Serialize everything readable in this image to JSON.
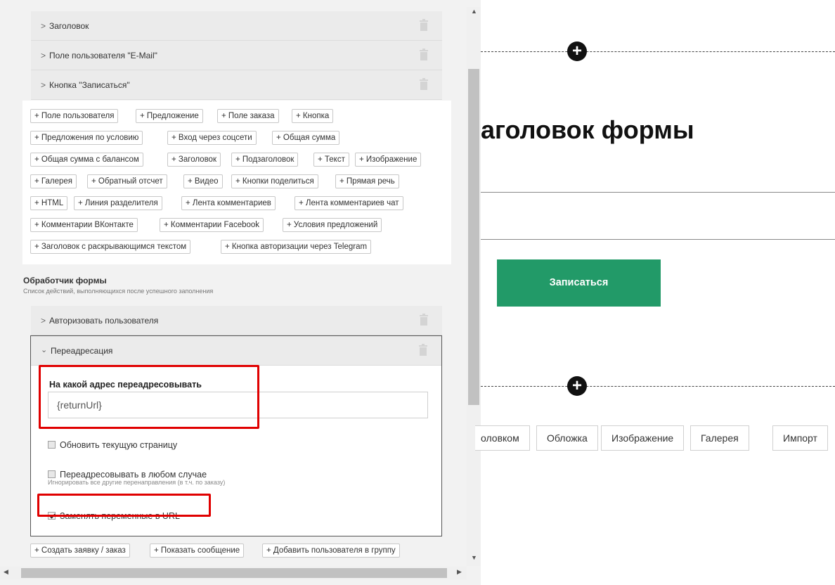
{
  "form_fields": [
    {
      "label": "Заголовок"
    },
    {
      "label": "Поле пользователя \"E-Mail\""
    },
    {
      "label": "Кнопка \"Записаться\""
    }
  ],
  "add_block_buttons": [
    "+ Поле пользователя",
    "+ Предложение",
    "+ Поле заказа",
    "+ Кнопка",
    "+ Предложения по условию",
    "+ Вход через соцсети",
    "+ Общая сумма",
    "+ Общая сумма с балансом",
    "+ Заголовок",
    "+ Подзаголовок",
    "+ Текст",
    "+ Изображение",
    "+ Галерея",
    "+ Обратный отсчет",
    "+ Видео",
    "+ Кнопки поделиться",
    "+ Прямая речь",
    "+ HTML",
    "+ Линия разделителя",
    "+ Лента комментариев",
    "+ Лента комментариев чат",
    "+ Комментарии ВКонтакте",
    "+ Комментарии Facebook",
    "+ Условия предложений",
    "+ Заголовок с раскрывающимся текстом",
    "+ Кнопка авторизации через Telegram"
  ],
  "handler": {
    "title": "Обработчик формы",
    "subtitle": "Список действий, выполняющихся после успешного заполнения",
    "actions": [
      {
        "label": "Авторизовать пользователя"
      }
    ],
    "redirect": {
      "label": "Переадресация",
      "url_label": "На какой адрес переадресовывать",
      "url_value": "{returnUrl}",
      "refresh_label": "Обновить текущую страницу",
      "refresh_checked": false,
      "always_label": "Переадресовывать в любом случае",
      "always_checked": false,
      "ignore_note": "Игнорировать все другие перенаправления (в т.ч. по заказу)",
      "replace_vars_label": "Заменять переменные в URL",
      "replace_vars_checked": true
    },
    "add_action_buttons": [
      "+ Создать заявку / заказ",
      "+ Показать сообщение",
      "+ Добавить пользователя в группу"
    ]
  },
  "preview": {
    "form_title": "аголовок формы",
    "subscribe_button": "Записаться",
    "toolbar": [
      "оловком",
      "Обложка",
      "Изображение",
      "Галерея",
      "Импорт"
    ]
  },
  "colors": {
    "accent_green": "#229a68",
    "highlight_red": "#e00000",
    "panel_bg": "#f2f2f2"
  }
}
